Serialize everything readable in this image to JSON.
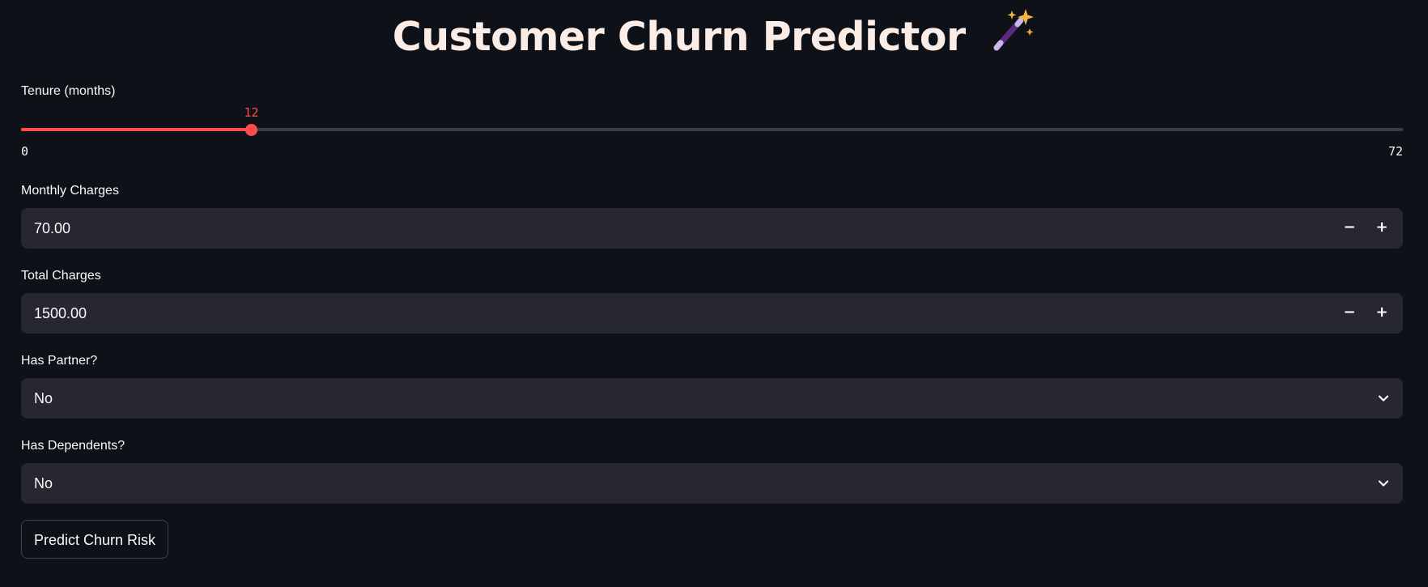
{
  "app": {
    "title": "Customer Churn Predictor",
    "title_icon": "magic-wand-icon"
  },
  "tenure": {
    "label": "Tenure (months)",
    "value": 12,
    "min": 0,
    "max": 72,
    "value_text": "12",
    "min_text": "0",
    "max_text": "72",
    "accent_color": "#ff4b4b"
  },
  "monthly_charges": {
    "label": "Monthly Charges",
    "value": "70.00",
    "decrement_symbol": "−",
    "increment_symbol": "+"
  },
  "total_charges": {
    "label": "Total Charges",
    "value": "1500.00",
    "decrement_symbol": "−",
    "increment_symbol": "+"
  },
  "has_partner": {
    "label": "Has Partner?",
    "selected": "No",
    "icon": "chevron-down-icon"
  },
  "has_dependents": {
    "label": "Has Dependents?",
    "selected": "No",
    "icon": "chevron-down-icon"
  },
  "predict_button": {
    "label": "Predict Churn Risk"
  },
  "colors": {
    "background": "#0e1117",
    "input_background": "#262730",
    "accent": "#ff4b4b",
    "title_text": "#fbece6"
  }
}
